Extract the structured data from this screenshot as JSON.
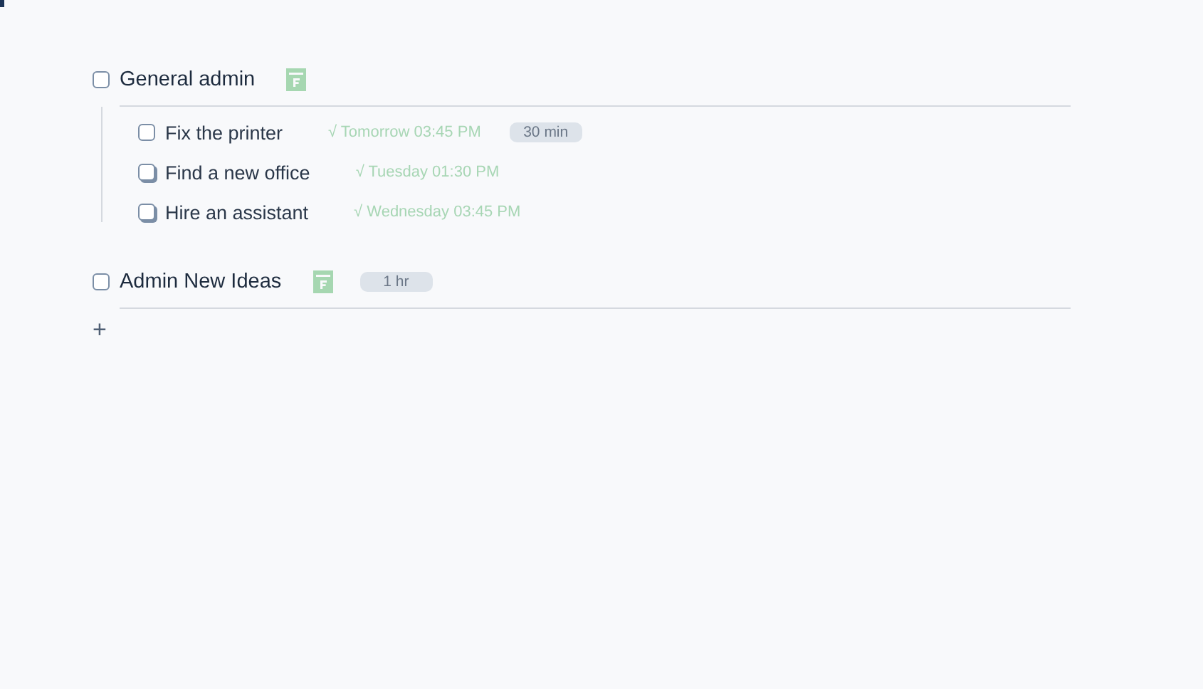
{
  "groups": [
    {
      "title": "General admin",
      "checked": false,
      "calendar": true,
      "tasks": [
        {
          "title": "Fix the printer",
          "kind": "single",
          "checked": false,
          "due": "√ Tomorrow 03:45 PM",
          "duration": "30 min"
        },
        {
          "title": "Find a new office",
          "kind": "stacked",
          "checked": false,
          "due": "√ Tuesday 01:30 PM"
        },
        {
          "title": "Hire an assistant",
          "kind": "stacked",
          "checked": false,
          "due": "√ Wednesday 03:45 PM"
        }
      ]
    },
    {
      "title": "Admin New Ideas",
      "checked": false,
      "calendar": true,
      "duration": "1 hr"
    }
  ],
  "add_button": "+"
}
